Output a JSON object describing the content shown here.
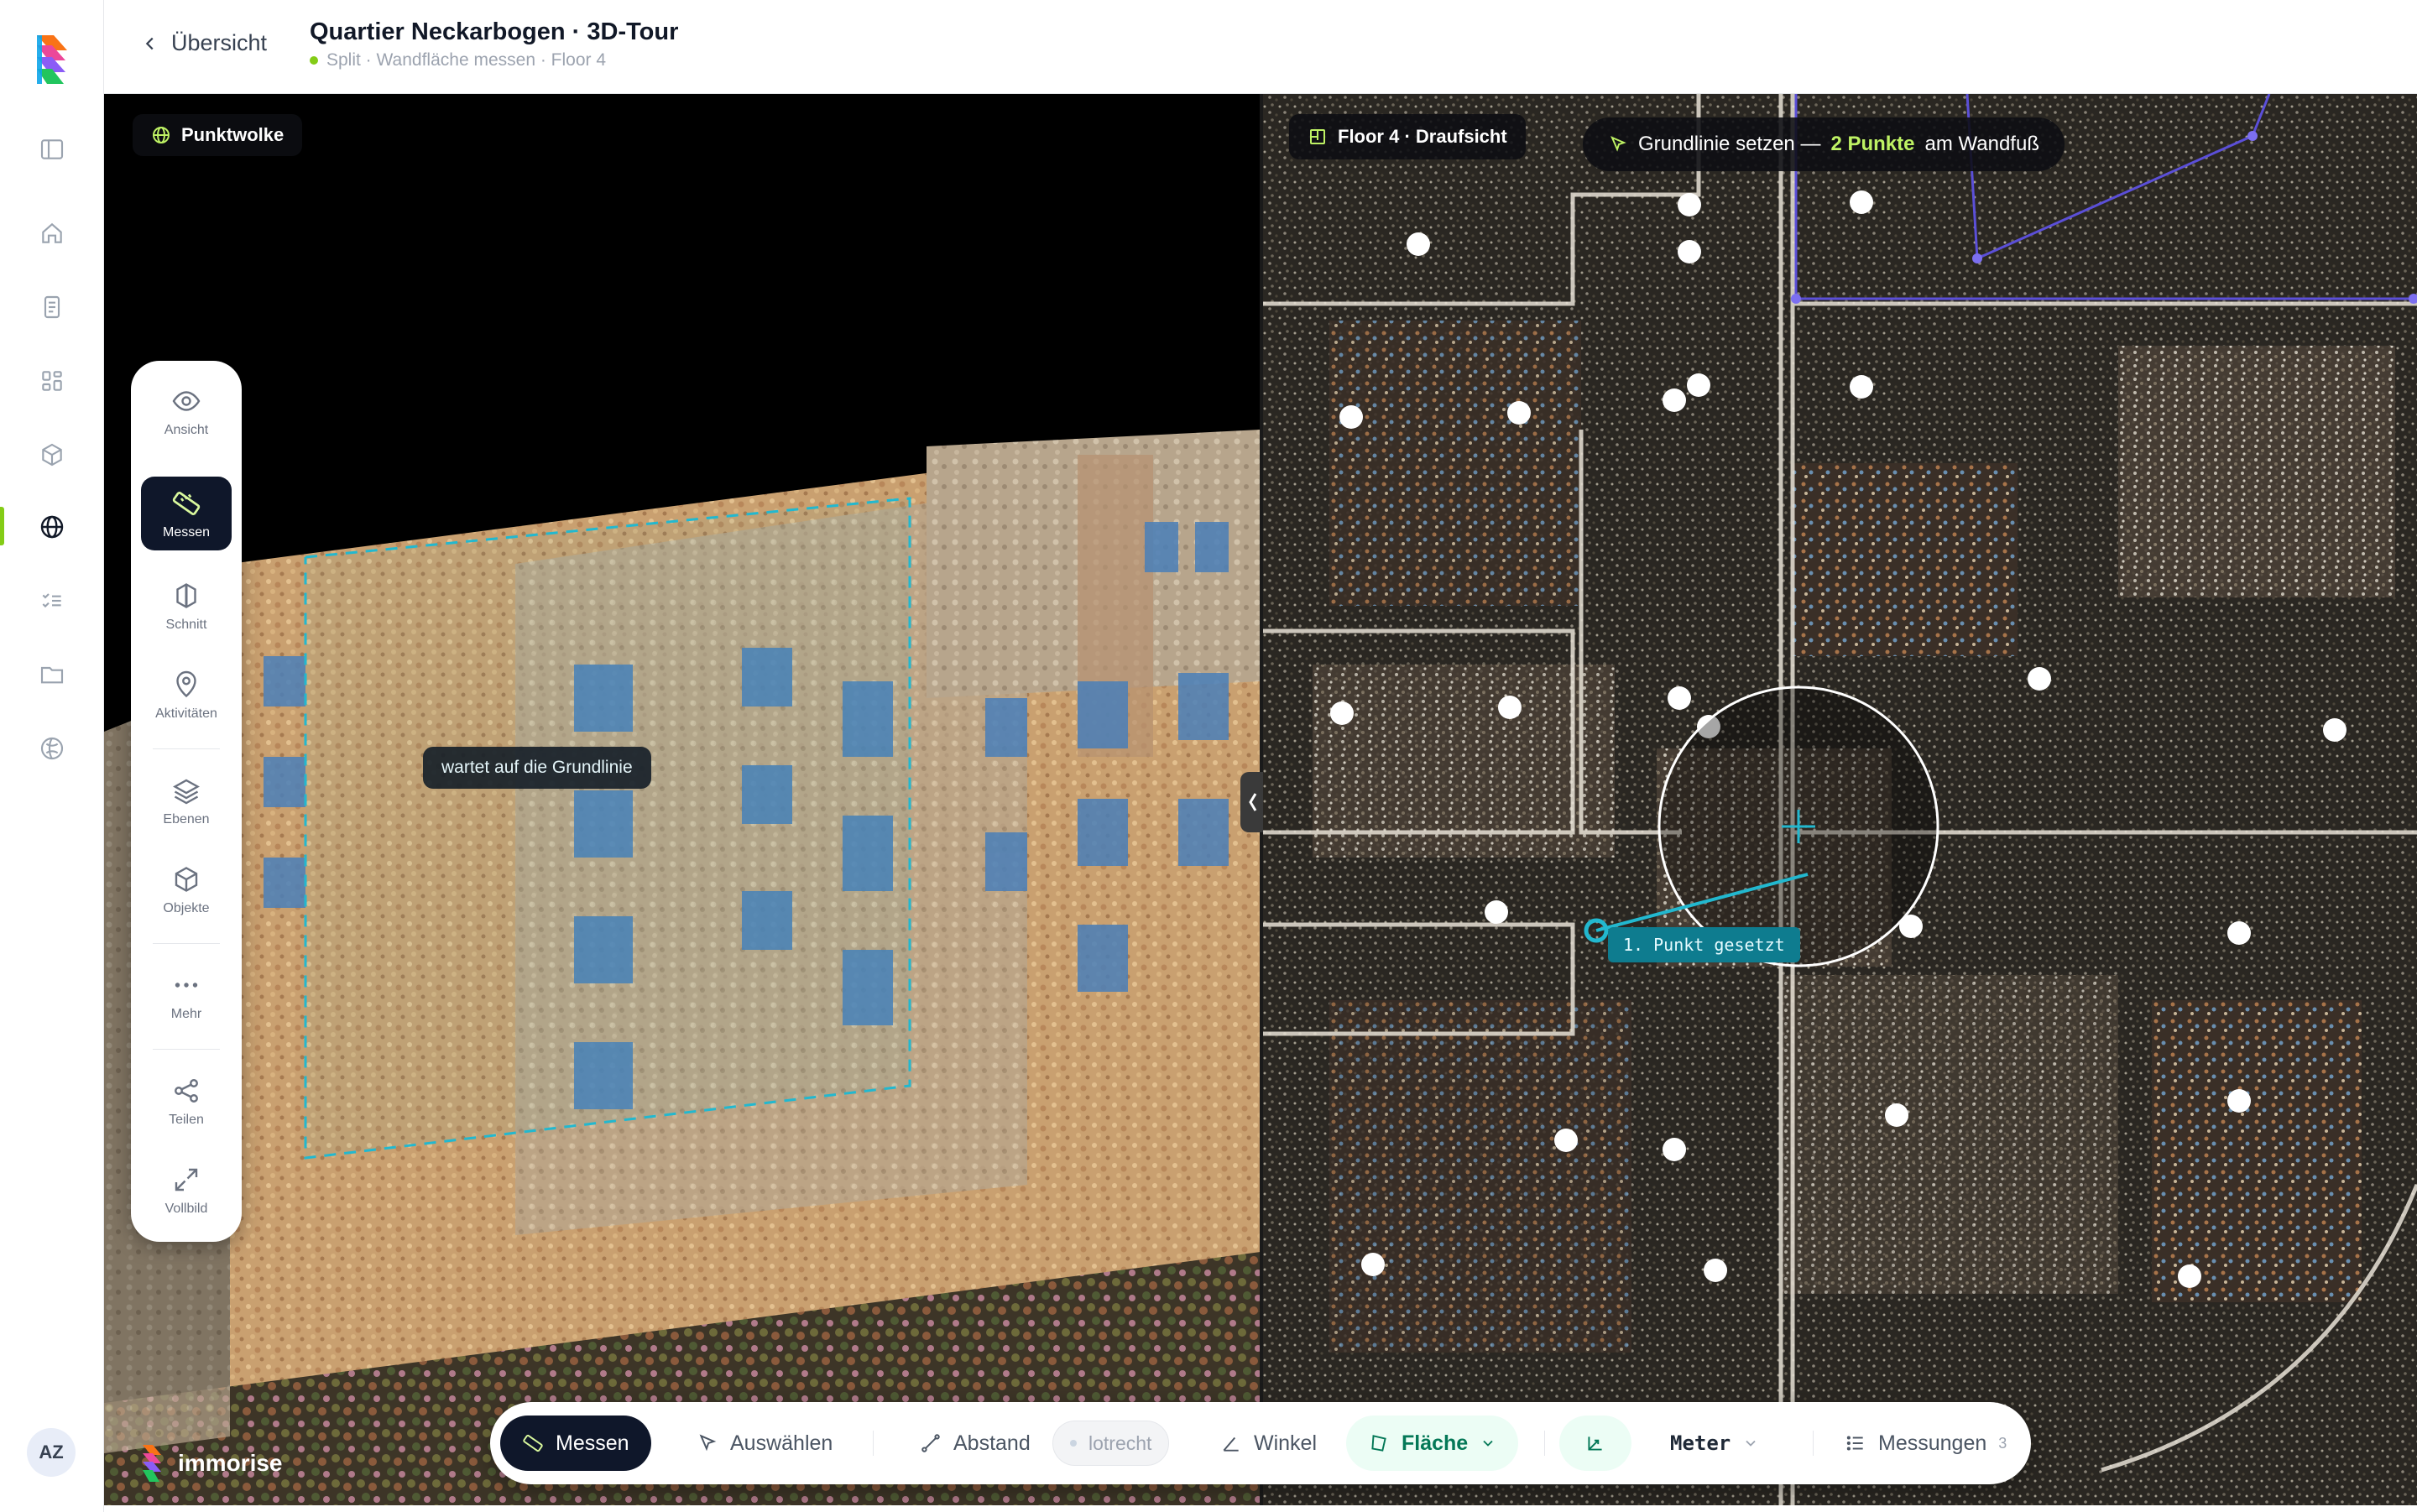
{
  "app": {
    "back_label": "Übersicht",
    "title": "Quartier Neckarbogen · 3D-Tour",
    "subtitle": "Split · Wandfläche messen · Floor 4",
    "status_color": "#84cc16",
    "avatar_initials": "AZ",
    "brand_name": "immorise"
  },
  "rail": {
    "items": [
      {
        "icon": "sidebar-toggle-icon"
      },
      {
        "icon": "home-icon"
      },
      {
        "icon": "document-icon"
      },
      {
        "icon": "dashboard-grid-icon"
      },
      {
        "icon": "cube-icon"
      },
      {
        "icon": "globe-icon",
        "active": true
      },
      {
        "icon": "checklist-icon"
      },
      {
        "icon": "folder-icon"
      },
      {
        "icon": "globe-alt-icon"
      }
    ]
  },
  "left_view": {
    "label": "Punktwolke",
    "tooltip": "wartet auf die Grundlinie"
  },
  "right_view": {
    "label": "Floor 4 · Draufsicht",
    "hint_prefix": "Grundlinie setzen —",
    "hint_highlight": "2 Punkte",
    "hint_suffix": "am Wandfuß",
    "point_label": "1. Punkt gesetzt",
    "accent_color": "#22b8cf",
    "hint_color": "#bef264"
  },
  "palette": {
    "items": [
      {
        "label": "Ansicht",
        "icon": "eye-icon"
      },
      {
        "label": "Messen",
        "icon": "ruler-icon",
        "active": true
      },
      {
        "label": "Schnitt",
        "icon": "section-icon"
      },
      {
        "label": "Aktivitäten",
        "icon": "map-pin-icon"
      },
      {
        "label": "Ebenen",
        "icon": "layers-icon"
      },
      {
        "label": "Objekte",
        "icon": "box-icon"
      },
      {
        "label": "Mehr",
        "icon": "more-icon"
      },
      {
        "label": "Teilen",
        "icon": "share-icon"
      },
      {
        "label": "Vollbild",
        "icon": "expand-icon"
      }
    ]
  },
  "toolbar": {
    "messen": "Messen",
    "auswaehlen": "Auswählen",
    "abstand": "Abstand",
    "lotrecht": "lotrecht",
    "winkel": "Winkel",
    "flaeche": "Fläche",
    "unit": "Meter",
    "messungen": "Messungen",
    "messungen_count": "3"
  }
}
